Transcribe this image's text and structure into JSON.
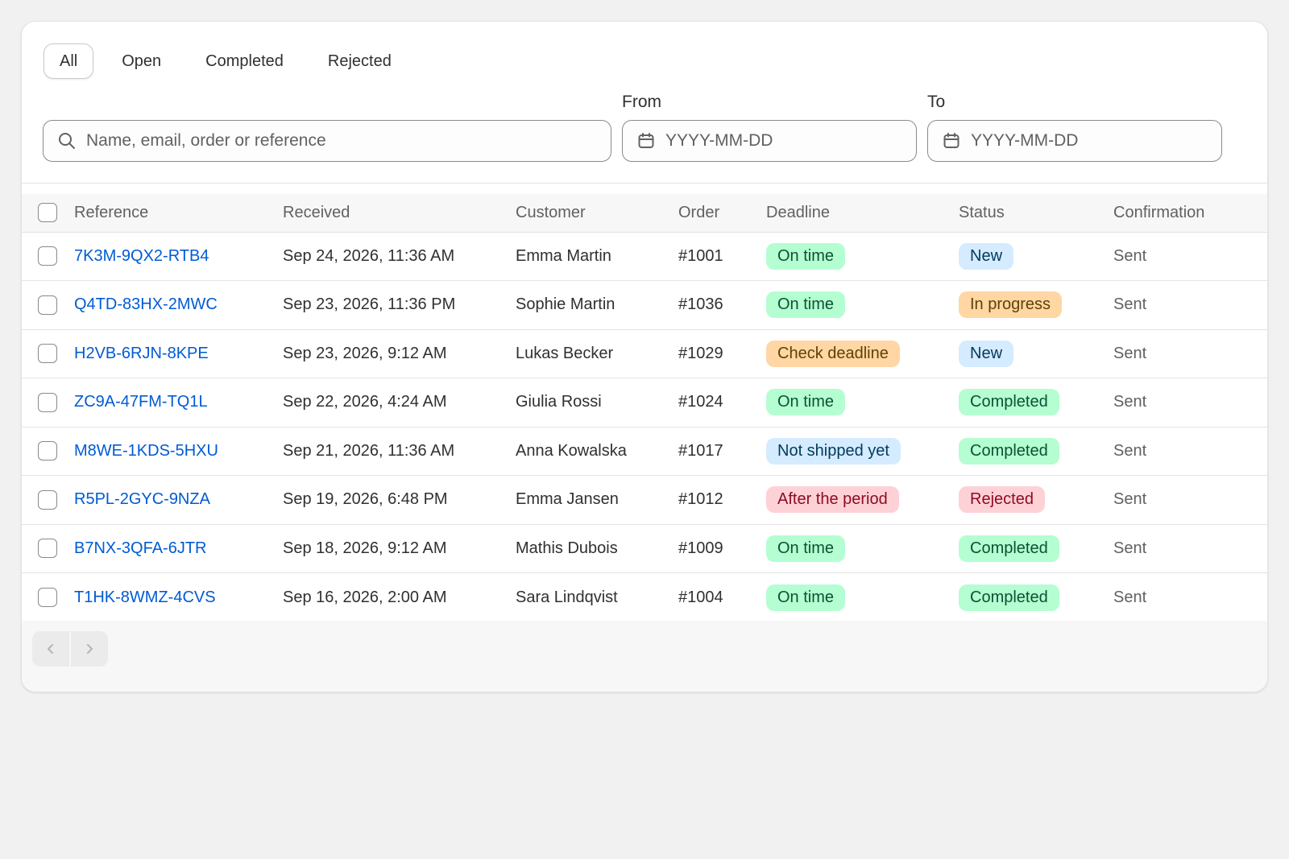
{
  "tabs": [
    {
      "label": "All",
      "active": true
    },
    {
      "label": "Open",
      "active": false
    },
    {
      "label": "Completed",
      "active": false
    },
    {
      "label": "Rejected",
      "active": false
    }
  ],
  "filters": {
    "search": {
      "placeholder": "Name, email, order or reference",
      "value": "",
      "icon": "search-icon"
    },
    "from": {
      "label": "From",
      "placeholder": "YYYY-MM-DD",
      "icon": "calendar-icon"
    },
    "to": {
      "label": "To",
      "placeholder": "YYYY-MM-DD",
      "icon": "calendar-icon"
    }
  },
  "table": {
    "columns": [
      "Reference",
      "Received",
      "Customer",
      "Order",
      "Deadline",
      "Status",
      "Confirmation"
    ],
    "rows": [
      {
        "reference": "7K3M-9QX2-RTB4",
        "received": "Sep 24, 2026, 11:36 AM",
        "customer": "Emma Martin",
        "order": "#1001",
        "deadline": "On time",
        "deadline_tone": "success",
        "status": "New",
        "status_tone": "info",
        "confirmation": "Sent"
      },
      {
        "reference": "Q4TD-83HX-2MWC",
        "received": "Sep 23, 2026, 11:36 PM",
        "customer": "Sophie Martin",
        "order": "#1036",
        "deadline": "On time",
        "deadline_tone": "success",
        "status": "In progress",
        "status_tone": "attention",
        "confirmation": "Sent"
      },
      {
        "reference": "H2VB-6RJN-8KPE",
        "received": "Sep 23, 2026, 9:12 AM",
        "customer": "Lukas Becker",
        "order": "#1029",
        "deadline": "Check deadline",
        "deadline_tone": "attention",
        "status": "New",
        "status_tone": "info",
        "confirmation": "Sent"
      },
      {
        "reference": "ZC9A-47FM-TQ1L",
        "received": "Sep 22, 2026, 4:24 AM",
        "customer": "Giulia Rossi",
        "order": "#1024",
        "deadline": "On time",
        "deadline_tone": "success",
        "status": "Completed",
        "status_tone": "success",
        "confirmation": "Sent"
      },
      {
        "reference": "M8WE-1KDS-5HXU",
        "received": "Sep 21, 2026, 11:36 AM",
        "customer": "Anna Kowalska",
        "order": "#1017",
        "deadline": "Not shipped yet",
        "deadline_tone": "info",
        "status": "Completed",
        "status_tone": "success",
        "confirmation": "Sent"
      },
      {
        "reference": "R5PL-2GYC-9NZA",
        "received": "Sep 19, 2026, 6:48 PM",
        "customer": "Emma Jansen",
        "order": "#1012",
        "deadline": "After the period",
        "deadline_tone": "critical",
        "status": "Rejected",
        "status_tone": "critical",
        "confirmation": "Sent"
      },
      {
        "reference": "B7NX-3QFA-6JTR",
        "received": "Sep 18, 2026, 9:12 AM",
        "customer": "Mathis Dubois",
        "order": "#1009",
        "deadline": "On time",
        "deadline_tone": "success",
        "status": "Completed",
        "status_tone": "success",
        "confirmation": "Sent"
      },
      {
        "reference": "T1HK-8WMZ-4CVS",
        "received": "Sep 16, 2026, 2:00 AM",
        "customer": "Sara Lindqvist",
        "order": "#1004",
        "deadline": "On time",
        "deadline_tone": "success",
        "status": "Completed",
        "status_tone": "success",
        "confirmation": "Sent"
      }
    ]
  },
  "badge_tones": {
    "success": {
      "bg": "#b4fed2",
      "fg": "#0c5132"
    },
    "info": {
      "bg": "#d5ebff",
      "fg": "#003a5a"
    },
    "attention": {
      "bg": "#ffd6a4",
      "fg": "#5e4200"
    },
    "critical": {
      "bg": "#fed1d7",
      "fg": "#8e0b21"
    }
  },
  "pagination": {
    "prev_icon": "chevron-left-icon",
    "next_icon": "chevron-right-icon",
    "prev_enabled": false,
    "next_enabled": false
  },
  "colors": {
    "link": "#005bd3",
    "background": "#f1f1f1",
    "card": "#ffffff"
  }
}
